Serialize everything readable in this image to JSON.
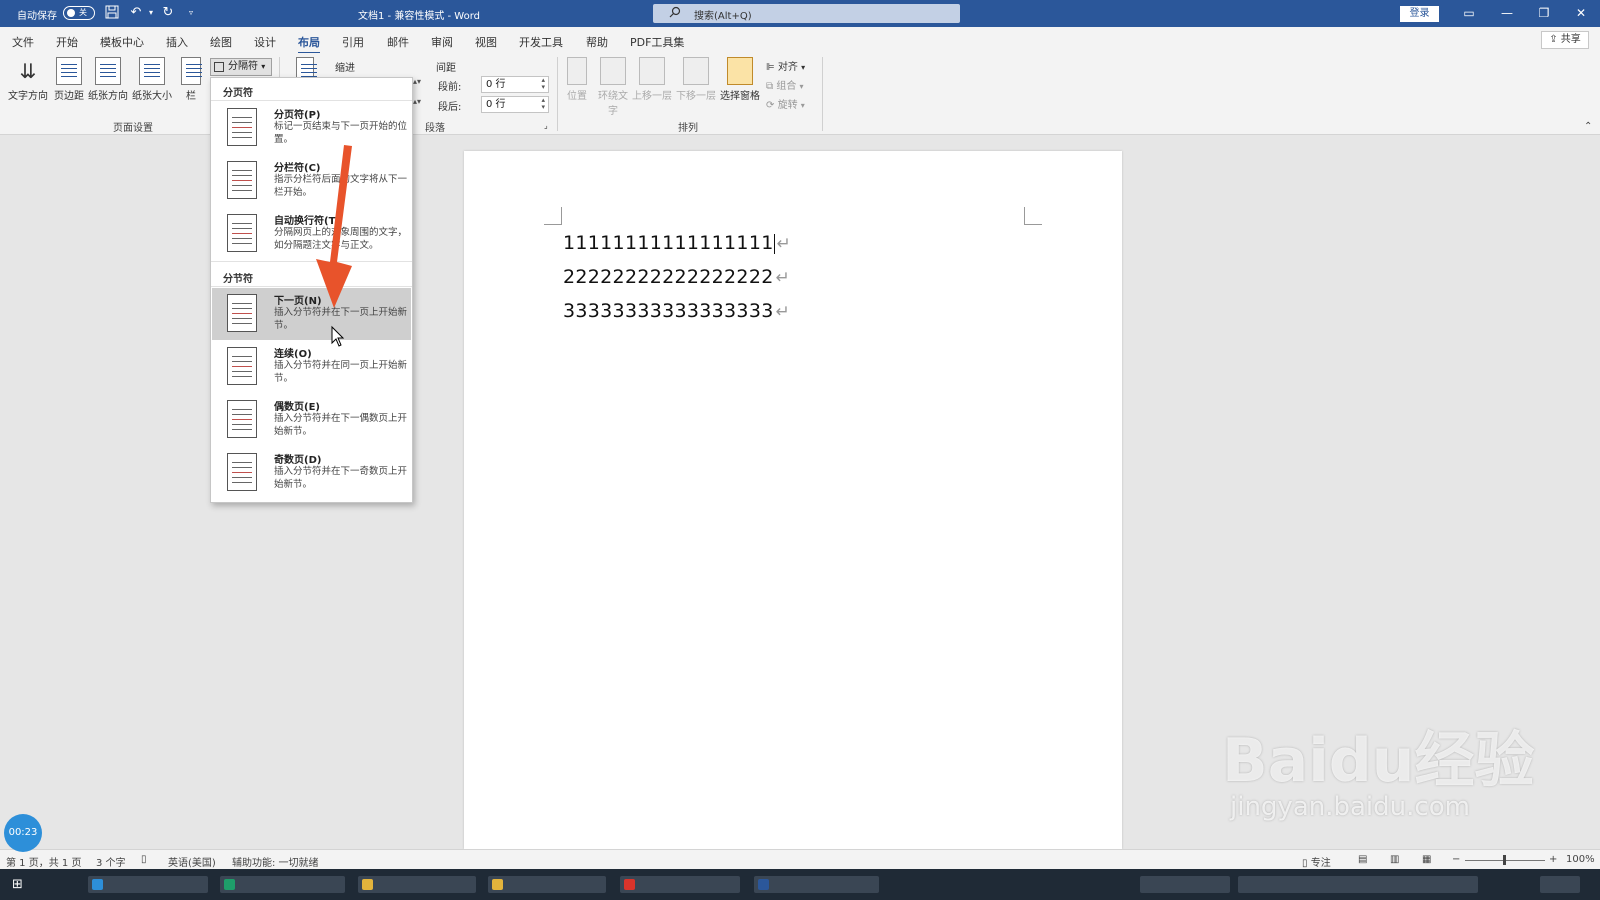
{
  "titlebar": {
    "autosave_label": "自动保存",
    "autosave_state": "关",
    "doc_title": "文档1 - 兼容性模式 - Word",
    "search_placeholder": "搜索(Alt+Q)",
    "login_label": "登录"
  },
  "menu": {
    "tabs": [
      "文件",
      "开始",
      "模板中心",
      "插入",
      "绘图",
      "设计",
      "布局",
      "引用",
      "邮件",
      "审阅",
      "视图",
      "开发工具",
      "帮助",
      "PDF工具集"
    ],
    "active": "布局",
    "share_label": "共享"
  },
  "ribbon": {
    "page_setup": {
      "buttons": [
        "文字方向",
        "页边距",
        "纸张方向",
        "纸张大小",
        "栏"
      ],
      "group_label": "页面设置"
    },
    "breaks_label": "分隔符",
    "indent_label": "缩进",
    "spacing_label": "间距",
    "before_label": "段前:",
    "before_value": "0 行",
    "after_label": "段后:",
    "after_value": "0 行",
    "paragraph_group_label": "段落",
    "arrange": {
      "buttons": [
        "位置",
        "环绕文字",
        "上移一层",
        "下移一层",
        "选择窗格"
      ],
      "side_items": [
        "对齐",
        "组合",
        "旋转"
      ],
      "group_label": "排列"
    }
  },
  "breaks_menu": {
    "page_breaks_header": "分页符",
    "section_breaks_header": "分节符",
    "items": [
      {
        "title": "分页符(P)",
        "desc": "标记一页结束与下一页开始的位置。"
      },
      {
        "title": "分栏符(C)",
        "desc": "指示分栏符后面的文字将从下一栏开始。"
      },
      {
        "title": "自动换行符(T)",
        "desc": "分隔网页上的对象周围的文字，如分隔题注文字与正文。"
      },
      {
        "title": "下一页(N)",
        "desc": "插入分节符并在下一页上开始新节。"
      },
      {
        "title": "连续(O)",
        "desc": "插入分节符并在同一页上开始新节。"
      },
      {
        "title": "偶数页(E)",
        "desc": "插入分节符并在下一偶数页上开始新节。"
      },
      {
        "title": "奇数页(D)",
        "desc": "插入分节符并在下一奇数页上开始新节。"
      }
    ],
    "highlighted": "下一页(N)"
  },
  "document": {
    "lines": [
      "11111111111111111",
      "22222222222222222",
      "33333333333333333"
    ],
    "paragraph_mark": "↵"
  },
  "statusbar": {
    "page": "第 1 页，共 1 页",
    "words": "3 个字",
    "language": "英语(美国)",
    "accessibility": "辅助功能: 一切就绪",
    "focus": "专注",
    "zoom": "100%"
  },
  "overlay": {
    "timer": "00:23",
    "watermark_main": "Baidu经验",
    "watermark_sub": "jingyan.baidu.com"
  },
  "colors": {
    "title_bar": "#2b579a",
    "annotation_arrow": "#e8532b",
    "timer_bubble": "#2d8fd9"
  }
}
